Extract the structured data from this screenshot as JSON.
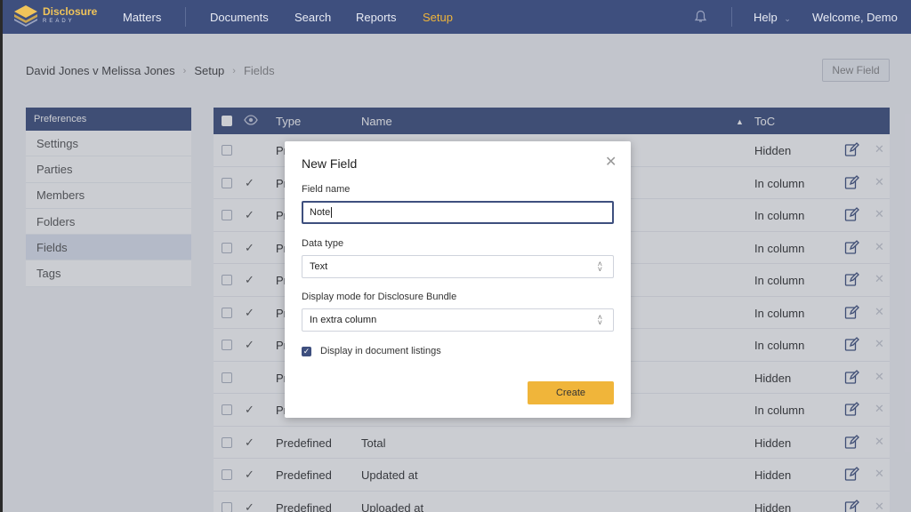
{
  "nav": {
    "logo_line1": "Disclosure",
    "logo_line2": "READY",
    "items": [
      "Matters",
      "Documents",
      "Search",
      "Reports",
      "Setup"
    ],
    "active": "Setup",
    "help_label": "Help",
    "welcome_label": "Welcome, Demo",
    "bell_icon": "bell-icon",
    "accent_color": "#f0b53a",
    "bar_color": "#3e4f7e"
  },
  "breadcrumb": [
    "David Jones v Melissa Jones",
    "Setup",
    "Fields"
  ],
  "new_field_button": "New Field",
  "sidebar": {
    "heading": "Preferences",
    "items": [
      "Settings",
      "Parties",
      "Members",
      "Folders",
      "Fields",
      "Tags"
    ],
    "active": "Fields"
  },
  "table": {
    "headers": {
      "type": "Type",
      "name": "Name",
      "toc": "ToC"
    },
    "rows": [
      {
        "checked": false,
        "type": "Pr",
        "name": "",
        "toc": "Hidden"
      },
      {
        "checked": true,
        "type": "Pr",
        "name": "",
        "toc": "In column"
      },
      {
        "checked": true,
        "type": "Pr",
        "name": "",
        "toc": "In column"
      },
      {
        "checked": true,
        "type": "Pr",
        "name": "",
        "toc": "In column"
      },
      {
        "checked": true,
        "type": "Pr",
        "name": "",
        "toc": "In column"
      },
      {
        "checked": true,
        "type": "Pr",
        "name": "",
        "toc": "In column"
      },
      {
        "checked": true,
        "type": "Pr",
        "name": "",
        "toc": "In column"
      },
      {
        "checked": false,
        "type": "Pr",
        "name": "",
        "toc": "Hidden"
      },
      {
        "checked": true,
        "type": "Pr",
        "name": "",
        "toc": "In column"
      },
      {
        "checked": true,
        "type": "Predefined",
        "name": "Total",
        "toc": "Hidden"
      },
      {
        "checked": true,
        "type": "Predefined",
        "name": "Updated at",
        "toc": "Hidden"
      },
      {
        "checked": true,
        "type": "Predefined",
        "name": "Uploaded at",
        "toc": "Hidden"
      }
    ]
  },
  "modal": {
    "title": "New Field",
    "field_name_label": "Field name",
    "field_name_value": "Note",
    "data_type_label": "Data type",
    "data_type_value": "Text",
    "display_mode_label": "Display mode for Disclosure Bundle",
    "display_mode_value": "In extra column",
    "checkbox_label": "Display in document listings",
    "checkbox_checked": true,
    "create_label": "Create"
  }
}
